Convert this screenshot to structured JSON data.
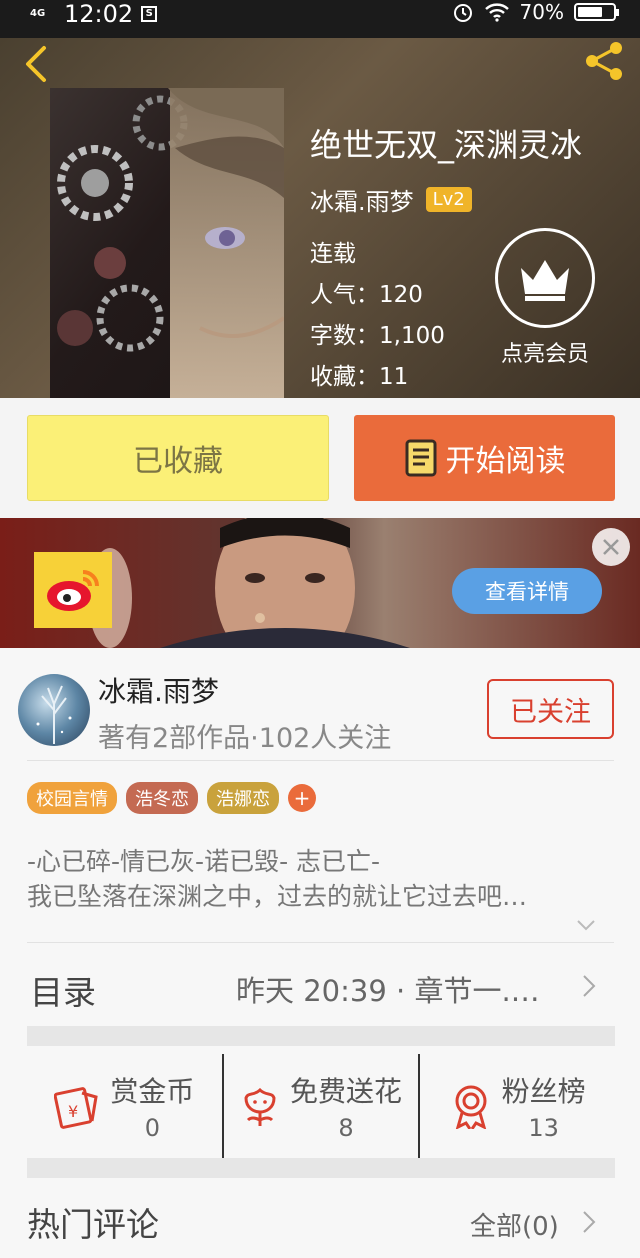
{
  "status_bar": {
    "network": "4G",
    "time": "12:02",
    "sim_icon": "S",
    "battery": "70%",
    "battery_level": 0.7
  },
  "book": {
    "title": "绝世无双_深渊灵冰",
    "author": "冰霜.雨梦",
    "level": "Lv2",
    "status": "连载",
    "popularity": "人气：120",
    "word_count": "字数：1,100",
    "favorites": "收藏：11",
    "vip_label": "点亮会员"
  },
  "actions": {
    "favorite_label": "已收藏",
    "read_label": "开始阅读"
  },
  "ad": {
    "detail_label": "查看详情"
  },
  "author_card": {
    "name": "冰霜.雨梦",
    "meta": "著有2部作品·102人关注",
    "follow_label": "已关注",
    "tags": [
      {
        "label": "校园言情",
        "color": "#f0a23c"
      },
      {
        "label": "浩冬恋",
        "color": "#c46a52"
      },
      {
        "label": "浩娜恋",
        "color": "#c9a23c"
      }
    ],
    "tag_add": "+",
    "intro_line1": "-心已碎-情已灰-诺已毁- 志已亡-",
    "intro_line2": "我已坠落在深渊之中，过去的就让它过去吧…"
  },
  "toc": {
    "label": "目录",
    "latest": "昨天 20:39 · 章节一.…"
  },
  "stats": [
    {
      "label": "赏金币",
      "value": "0",
      "icon": "red-envelope-icon"
    },
    {
      "label": "免费送花",
      "value": "8",
      "icon": "flower-icon"
    },
    {
      "label": "粉丝榜",
      "value": "13",
      "icon": "medal-icon"
    }
  ],
  "comments": {
    "label": "热门评论",
    "all_label": "全部(0)"
  },
  "colors": {
    "accent_orange": "#ea6b3b",
    "favorite_yellow": "#fbf077",
    "follow_red": "#d9402f",
    "level_gold": "#f0b429"
  }
}
